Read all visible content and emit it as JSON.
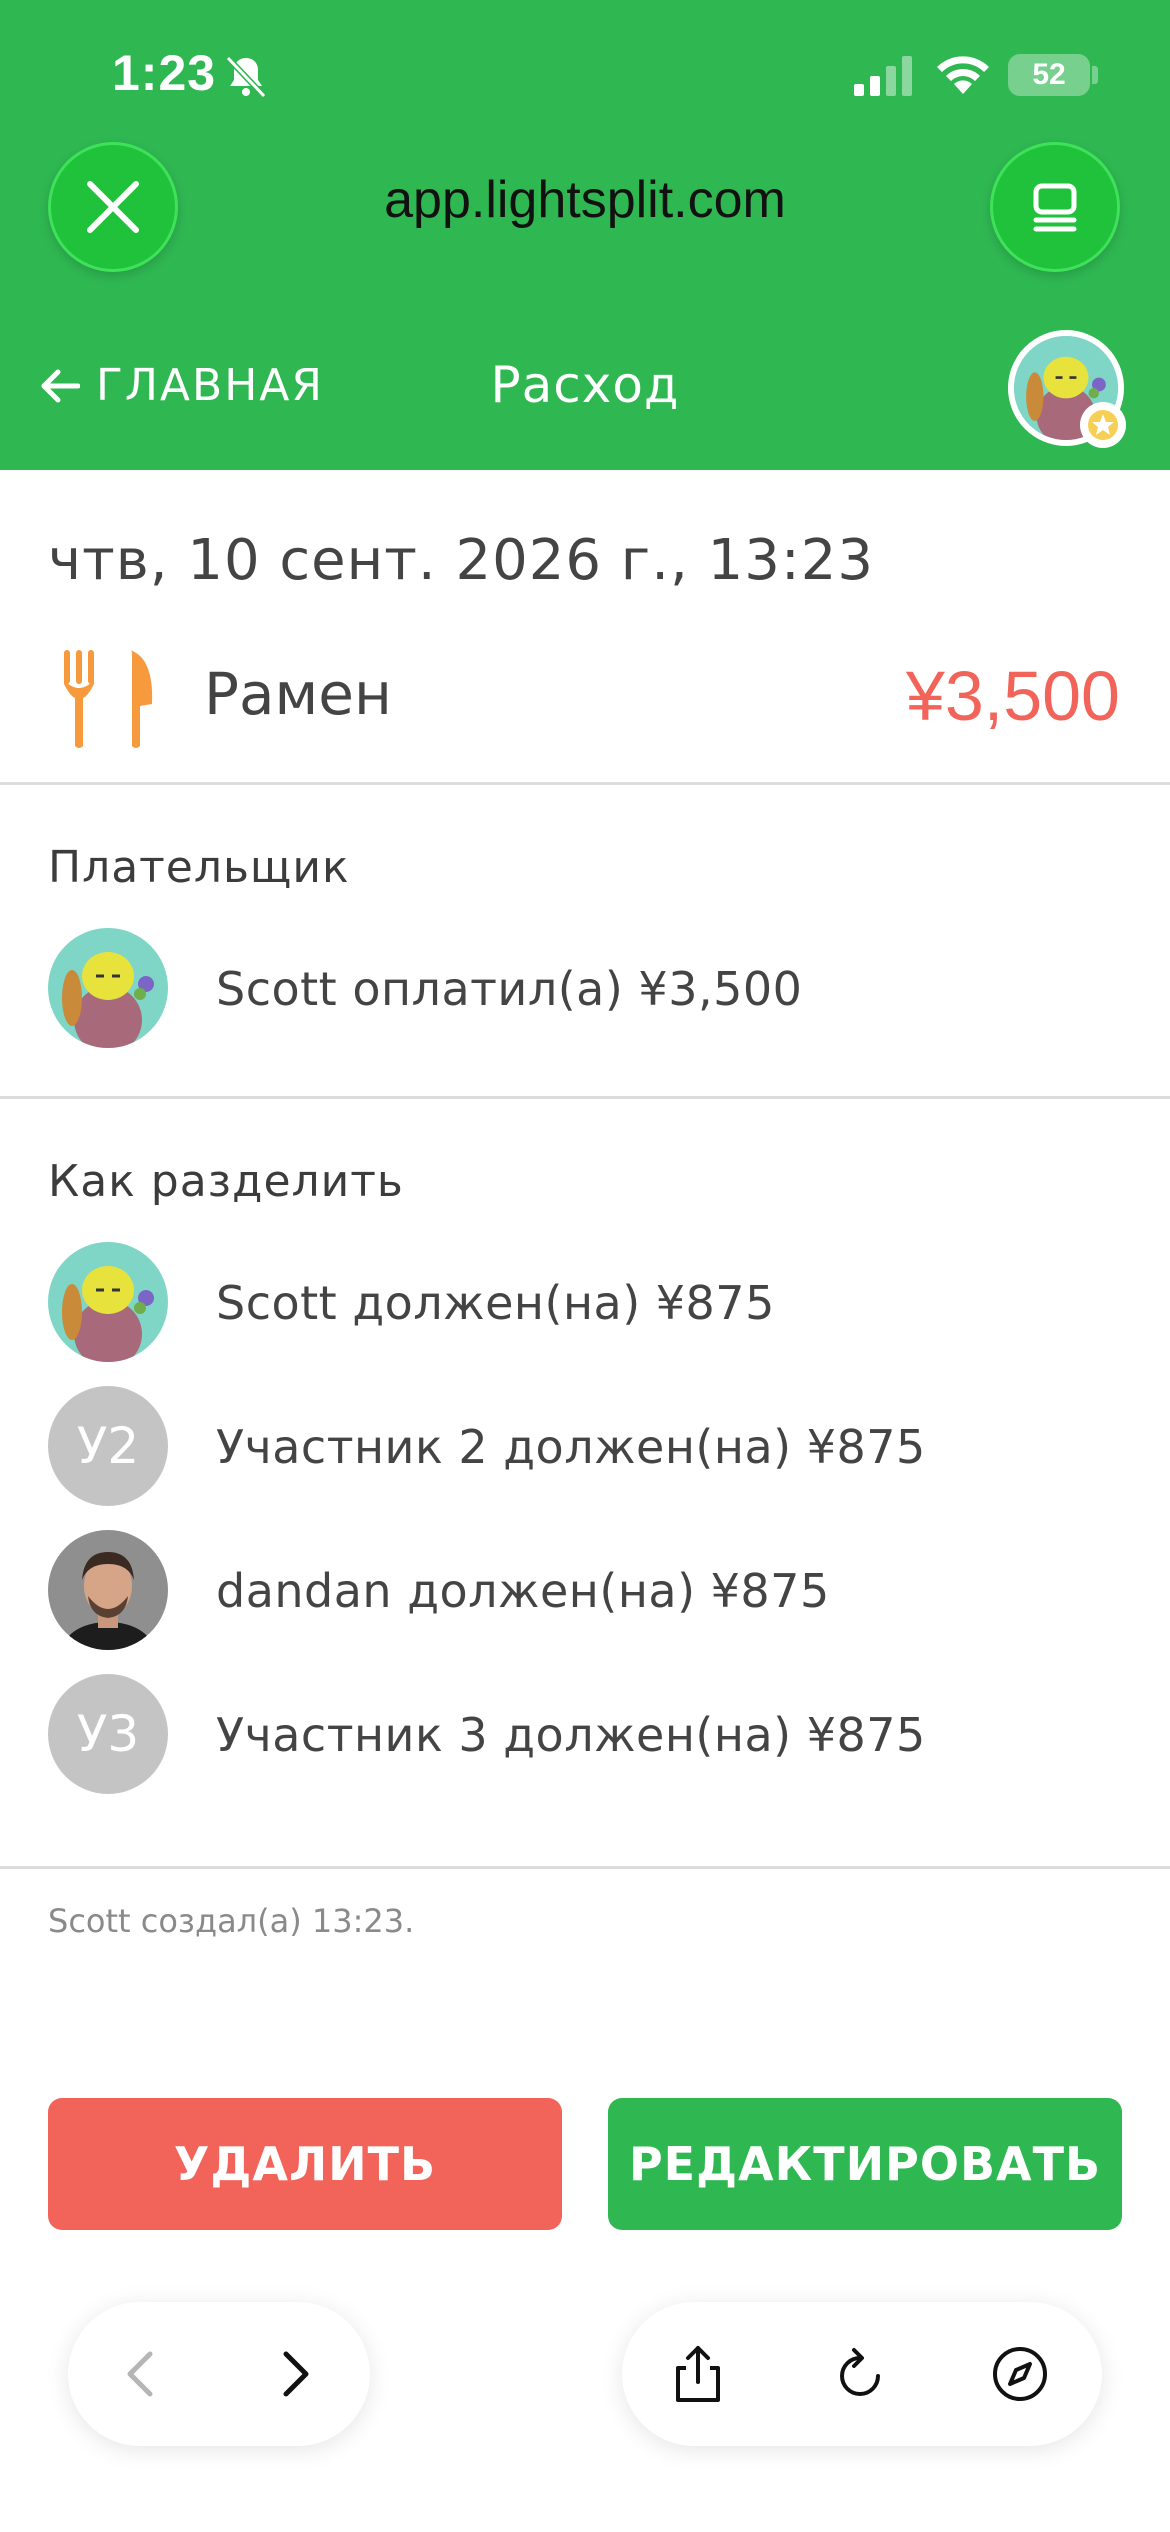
{
  "status_bar": {
    "time": "1:23",
    "battery": "52"
  },
  "browser": {
    "url": "app.lightsplit.com"
  },
  "nav": {
    "back_label": "ГЛАВНАЯ",
    "title": "Расход"
  },
  "expense": {
    "datetime": "чтв, 10 сент. 2026 г., 13:23",
    "category_icon": "fork-knife-icon",
    "name": "Рамен",
    "amount": "¥3,500"
  },
  "payer_section": {
    "title": "Плательщик",
    "rows": [
      {
        "text": "Scott оплатил(а) ¥3,500",
        "avatar": "character"
      }
    ]
  },
  "split_section": {
    "title": "Как разделить",
    "rows": [
      {
        "text": "Scott должен(на) ¥875",
        "avatar": "character"
      },
      {
        "text": "Участник 2 должен(на) ¥875",
        "initials": "У2"
      },
      {
        "text": "dandan должен(на) ¥875",
        "avatar": "photo"
      },
      {
        "text": "Участник 3 должен(на) ¥875",
        "initials": "У3"
      }
    ]
  },
  "footer_note": "Scott создал(а) 13:23.",
  "actions": {
    "delete_label": "УДАЛИТЬ",
    "edit_label": "РЕДАКТИРОВАТЬ"
  },
  "colors": {
    "brand_green": "#2fb752",
    "danger_red": "#f2645a"
  }
}
